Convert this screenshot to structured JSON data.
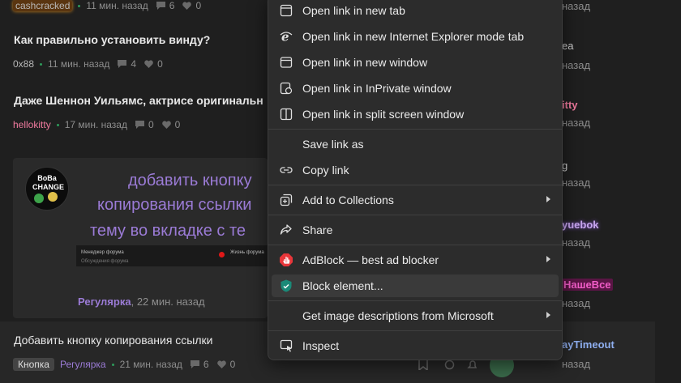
{
  "feed": {
    "post0": {
      "author": "cashcracked",
      "time": "11 мин. назад",
      "comments": "6",
      "likes": "0"
    },
    "post1": {
      "title": "Как правильно установить винду?",
      "author": "0x88",
      "time": "11 мин. назад",
      "comments": "4",
      "likes": "0"
    },
    "post2": {
      "title": "Даже Шеннон Уильямс, актрисе оригинальн",
      "author": "hellokitty",
      "time": "17 мин. назад",
      "comments": "0",
      "likes": "0"
    },
    "preview": {
      "avatar_text": "BoBa CHANGE",
      "line1": "добавить кнопку",
      "line2": "копирования ссылки",
      "line3": "тему во вкладке с те",
      "mini_left": "Менеджер форума",
      "mini_right": "Жизнь форума",
      "mini_sub": "Обсуждения форума",
      "category": "Регулярка",
      "time": "22 мин. назад"
    },
    "post4": {
      "title": "Добавить кнопку копирования ссылки",
      "tag": "Кнопка",
      "category": "Регулярка",
      "time": "21 мин. назад",
      "comments": "6",
      "likes": "0"
    }
  },
  "right_column": {
    "r1": "назад",
    "r2": "ea",
    "r3": "назад",
    "r4": "itty",
    "r5": "назад",
    "r6": "g",
    "r7": "назад",
    "r8": "yuebok",
    "r9": "назад",
    "r10": "НашеВсе",
    "r11": "назад",
    "r12": "ayTimeout",
    "r13": "назад"
  },
  "context_menu": {
    "items": [
      {
        "label": "Open link in new tab"
      },
      {
        "label": "Open link in new Internet Explorer mode tab"
      },
      {
        "label": "Open link in new window"
      },
      {
        "label": "Open link in InPrivate window"
      },
      {
        "label": "Open link in split screen window"
      },
      {
        "label": "Save link as"
      },
      {
        "label": "Copy link"
      },
      {
        "label": "Add to Collections"
      },
      {
        "label": "Share"
      },
      {
        "label": "AdBlock — best ad blocker"
      },
      {
        "label": "Block element..."
      },
      {
        "label": "Get image descriptions from Microsoft"
      },
      {
        "label": "Inspect"
      }
    ]
  },
  "colors": {
    "background": "#1f1f1f",
    "menu_background": "#2c2c2c",
    "menu_highlight": "#3a3a3a",
    "accent_purple": "#9b7bd6",
    "status_dot": "#2e9a5a"
  }
}
